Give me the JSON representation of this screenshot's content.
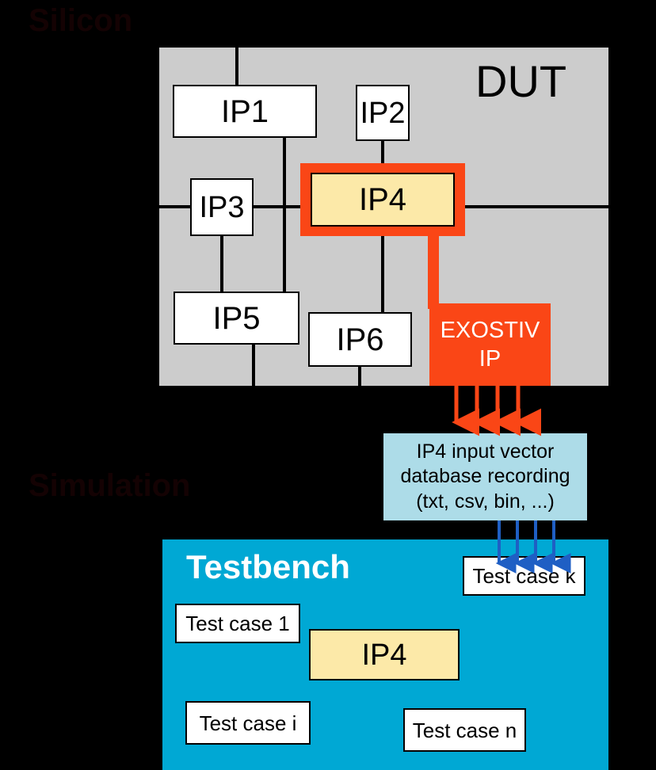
{
  "sections": {
    "silicon_caption": "Silicon",
    "simulation_caption": "Simulation"
  },
  "dut": {
    "title": "DUT",
    "background_color": "#cccccc",
    "blocks": [
      {
        "id": "ip1",
        "label": "IP1"
      },
      {
        "id": "ip2",
        "label": "IP2"
      },
      {
        "id": "ip3",
        "label": "IP3"
      },
      {
        "id": "ip4",
        "label": "IP4"
      },
      {
        "id": "ip5",
        "label": "IP5"
      },
      {
        "id": "ip6",
        "label": "IP6"
      }
    ],
    "highlight_color": "#fa4616",
    "highlight_fill": "#fce9a8",
    "exostiv": {
      "line1": "EXOSTIV",
      "line2": "IP",
      "color": "#fa4616",
      "text_color": "#ffffff"
    }
  },
  "database": {
    "line1": "IP4 input vector",
    "line2": "database recording",
    "line3": "(txt, csv, bin, ...)",
    "background_color": "#addce8"
  },
  "arrows": {
    "recording_arrow_color": "#fa4616",
    "recording_arrow_count": 4,
    "playback_arrow_color": "#1f5fc4",
    "playback_arrow_count": 4
  },
  "testbench": {
    "title": "Testbench",
    "background_color": "#00a8d4",
    "title_color": "#ffffff",
    "dut_under_test": {
      "label": "IP4",
      "fill": "#fce9a8"
    },
    "test_cases": [
      {
        "id": "tc-k",
        "label": "Test case k"
      },
      {
        "id": "tc-1",
        "label": "Test case 1"
      },
      {
        "id": "tc-i",
        "label": "Test case i"
      },
      {
        "id": "tc-n",
        "label": "Test case n"
      }
    ]
  }
}
